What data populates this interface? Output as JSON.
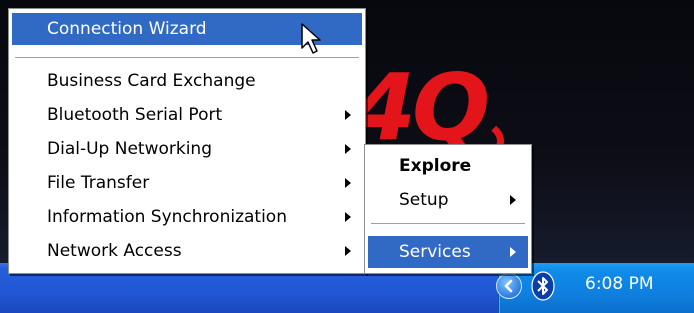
{
  "desktop": {
    "wallpaper_text": "4Q"
  },
  "main_menu": {
    "highlighted": "Connection Wizard",
    "items": [
      {
        "label": "Connection Wizard",
        "has_submenu": false
      },
      {
        "label": "Business Card Exchange",
        "has_submenu": false
      },
      {
        "label": "Bluetooth Serial Port",
        "has_submenu": true
      },
      {
        "label": "Dial-Up Networking",
        "has_submenu": true
      },
      {
        "label": "File Transfer",
        "has_submenu": true
      },
      {
        "label": "Information Synchronization",
        "has_submenu": true
      },
      {
        "label": "Network Access",
        "has_submenu": true
      }
    ]
  },
  "sub_menu": {
    "items": [
      {
        "label": "Explore",
        "bold": true,
        "has_submenu": false
      },
      {
        "label": "Setup",
        "has_submenu": true
      },
      {
        "label": "Services",
        "has_submenu": true,
        "highlighted": true
      }
    ]
  },
  "taskbar": {
    "clock": "6:08 PM",
    "tray_icons": [
      "show-hidden-icons-chevron-icon",
      "bluetooth-icon"
    ]
  },
  "colors": {
    "highlight": "#316ac5",
    "taskbar": "#245ddb",
    "tray": "#0f80e0",
    "wallpaper_logo": "#e3151b"
  }
}
